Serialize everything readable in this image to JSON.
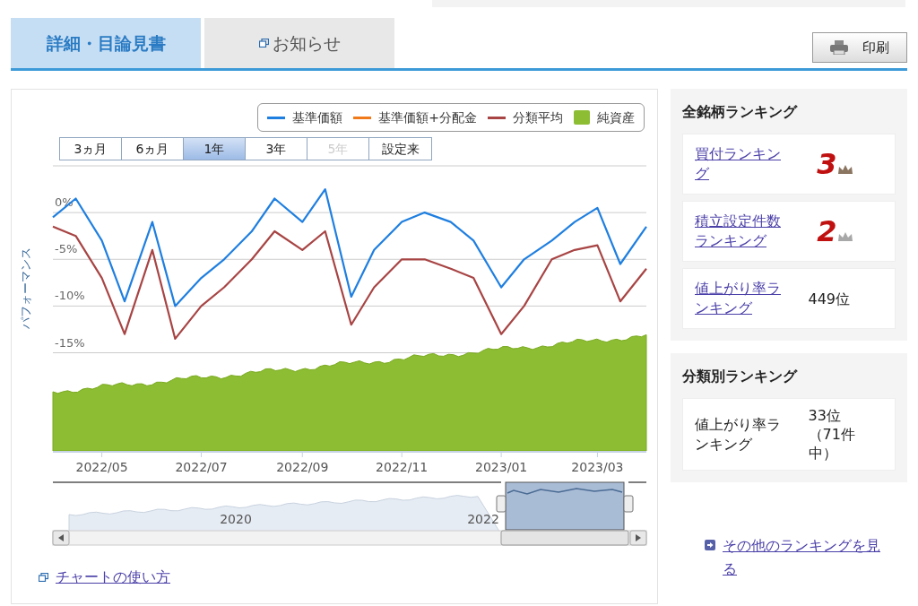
{
  "tabs": [
    {
      "label": "詳細・目論見書",
      "selected": true,
      "icon": false
    },
    {
      "label": "お知らせ",
      "selected": false,
      "icon": true
    }
  ],
  "print_button": {
    "label": "印刷"
  },
  "chart": {
    "legend_extra": [
      {
        "label": "純資産",
        "color": "#8cbd32",
        "kind": "area"
      }
    ],
    "periods": [
      {
        "label": "3ヵ月",
        "selected": false,
        "disabled": false
      },
      {
        "label": "6ヵ月",
        "selected": false,
        "disabled": false
      },
      {
        "label": "1年",
        "selected": true,
        "disabled": false
      },
      {
        "label": "3年",
        "selected": false,
        "disabled": false
      },
      {
        "label": "5年",
        "selected": false,
        "disabled": true
      },
      {
        "label": "設定来",
        "selected": false,
        "disabled": false
      }
    ],
    "chart_data": {
      "type": "line",
      "ylabel": "パフォーマンス",
      "grid": true,
      "x": [
        "2022-04-01",
        "2022-04-15",
        "2022-05-01",
        "2022-05-15",
        "2022-06-01",
        "2022-06-15",
        "2022-07-01",
        "2022-07-15",
        "2022-08-01",
        "2022-08-15",
        "2022-09-01",
        "2022-09-15",
        "2022-10-01",
        "2022-10-15",
        "2022-11-01",
        "2022-11-15",
        "2022-12-01",
        "2022-12-15",
        "2023-01-01",
        "2023-01-15",
        "2023-02-01",
        "2023-02-15",
        "2023-03-01",
        "2023-03-15",
        "2023-03-31"
      ],
      "series": [
        {
          "name": "基準価額",
          "color": "#1f7fe0",
          "values": [
            -0.5,
            1.5,
            -3,
            -9.5,
            -1,
            -10,
            -7,
            -5,
            -2,
            1.5,
            -1,
            2.5,
            -9,
            -4,
            -1,
            0,
            -1,
            -3,
            -8,
            -5,
            -3,
            -1,
            0.5,
            -5.5,
            -1.5
          ]
        },
        {
          "name": "基準価額+分配金",
          "color": "#f07a1a",
          "values": [
            null,
            null,
            null,
            null,
            null,
            null,
            null,
            null,
            null,
            null,
            null,
            null,
            null,
            null,
            null,
            null,
            null,
            null,
            null,
            null,
            null,
            null,
            null,
            null,
            null
          ]
        },
        {
          "name": "分類平均",
          "color": "#a84444",
          "values": [
            -1.5,
            -2.5,
            -7,
            -13,
            -4,
            -13.5,
            -10,
            -8,
            -5,
            -2,
            -4,
            -2,
            -12,
            -8,
            -5,
            -5,
            -6,
            -7,
            -13,
            -10,
            -5,
            -4,
            -3.5,
            -9.5,
            -6
          ]
        }
      ],
      "xlim": [
        "2022-04-01",
        "2023-03-31"
      ],
      "ylim": [
        -25.5,
        5
      ],
      "yticks": [
        {
          "value": 0,
          "label": "0%"
        },
        {
          "value": -5,
          "label": "-5%"
        },
        {
          "value": -10,
          "label": "-10%"
        },
        {
          "value": -15,
          "label": "-15%"
        }
      ],
      "xticks": [
        {
          "value": "2022-05-01",
          "label": "2022/05"
        },
        {
          "value": "2022-07-01",
          "label": "2022/07"
        },
        {
          "value": "2022-09-01",
          "label": "2022/09"
        },
        {
          "value": "2022-11-01",
          "label": "2022/11"
        },
        {
          "value": "2023-01-01",
          "label": "2023/01"
        },
        {
          "value": "2023-03-01",
          "label": "2023/03"
        }
      ]
    },
    "navigator_labels": [
      "2020",
      "2022"
    ],
    "help_link": "チャートの使い方"
  },
  "ranking_sections": [
    {
      "title": "全銘柄ランキング",
      "items": [
        {
          "label": "買付ランキング",
          "link": true,
          "kind": "medal",
          "rank": "3",
          "color": "#8a7560"
        },
        {
          "label": "積立設定件数ランキング",
          "link": true,
          "kind": "medal",
          "rank": "2",
          "color": "#a8a8a8"
        },
        {
          "label": "値上がり率ランキング",
          "link": true,
          "kind": "text",
          "rank": "449位"
        }
      ]
    },
    {
      "title": "分類別ランキング",
      "items": [
        {
          "label": "値上がり率ランキング",
          "link": false,
          "kind": "text",
          "rank": "33位（71件中）"
        }
      ]
    }
  ],
  "more_link": "その他のランキングを見る"
}
